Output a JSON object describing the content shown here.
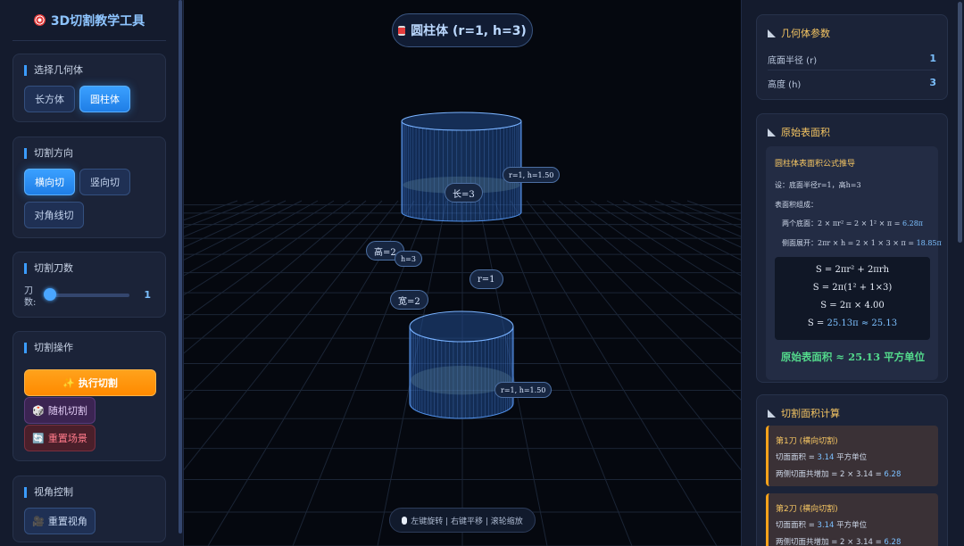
{
  "app": {
    "title": "3D切割教学工具",
    "title_icon": "dart-icon"
  },
  "left": {
    "geometry": {
      "title": "选择几何体",
      "options": [
        "长方体",
        "圆柱体"
      ],
      "selected": "圆柱体"
    },
    "direction": {
      "title": "切割方向",
      "options": [
        "横向切",
        "竖向切",
        "对角线切"
      ],
      "selected": "横向切"
    },
    "cuts": {
      "title": "切割刀数",
      "label": "刀数:",
      "value": "1",
      "min": 1,
      "max": 10
    },
    "actions": {
      "title": "切割操作",
      "execute": "执行切割",
      "random": "随机切割",
      "reset": "重置场景",
      "execute_icon": "sparkle-icon",
      "random_icon": "dice-icon",
      "reset_icon": "refresh-icon"
    },
    "view": {
      "title": "视角控制",
      "reset": "重置视角",
      "reset_icon": "camera-icon"
    }
  },
  "viewport": {
    "title": "圆柱体 (r=1, h=3)",
    "labels": {
      "len": "长=3",
      "top_piece": "r=1, h=1.50",
      "height": "高=2",
      "h": "h=3",
      "radius": "r=1",
      "width": "宽=2",
      "bottom_piece": "r=1, h=1.50"
    },
    "hint": "左键旋转 | 右键平移 | 滚轮缩放"
  },
  "right": {
    "params": {
      "title": "几何体参数",
      "rows": [
        {
          "label": "底面半径 (r)",
          "value": "1"
        },
        {
          "label": "高度 (h)",
          "value": "3"
        }
      ]
    },
    "surface": {
      "title": "原始表面积",
      "derive_title": "圆柱体表面积公式推导",
      "given": "设：底面半径r=1，高h=3",
      "compose": "表面积组成：",
      "bases_label": "两个底面：",
      "bases_formula": "2 × πr² = 2 × 1² × π = ",
      "bases_value": "6.28π",
      "side_label": "侧面展开：",
      "side_formula": "2πr × h = 2 × 1 × 3 × π = ",
      "side_value": "18.85π",
      "formula_lines": [
        "S = 2πr² + 2πrh",
        "S = 2π(1² + 1×3)",
        "S = 2π × 4.00"
      ],
      "formula_final_prefix": "S = ",
      "formula_final_value": "25.13π ≈ 25.13",
      "result": "原始表面积 ≈ 25.13 平方单位"
    },
    "cut_area": {
      "title": "切割面积计算",
      "cuts": [
        {
          "title": "第1刀 (横向切割)",
          "area_label": "切面面积 = ",
          "area_value": "3.14",
          "area_unit": " 平方单位",
          "increase_label": "两侧切面共增加 = 2 × 3.14 = ",
          "increase_value": "6.28"
        },
        {
          "title": "第2刀 (横向切割)",
          "area_label": "切面面积 = ",
          "area_value": "3.14",
          "area_unit": " 平方单位",
          "increase_label": "两侧切面共增加 = 2 × 3.14 = ",
          "increase_value": "6.28"
        }
      ]
    }
  },
  "colors": {
    "accent": "#3aa0ff",
    "orange": "#ff9500",
    "green": "#53d98c",
    "gold": "#f6c663"
  }
}
